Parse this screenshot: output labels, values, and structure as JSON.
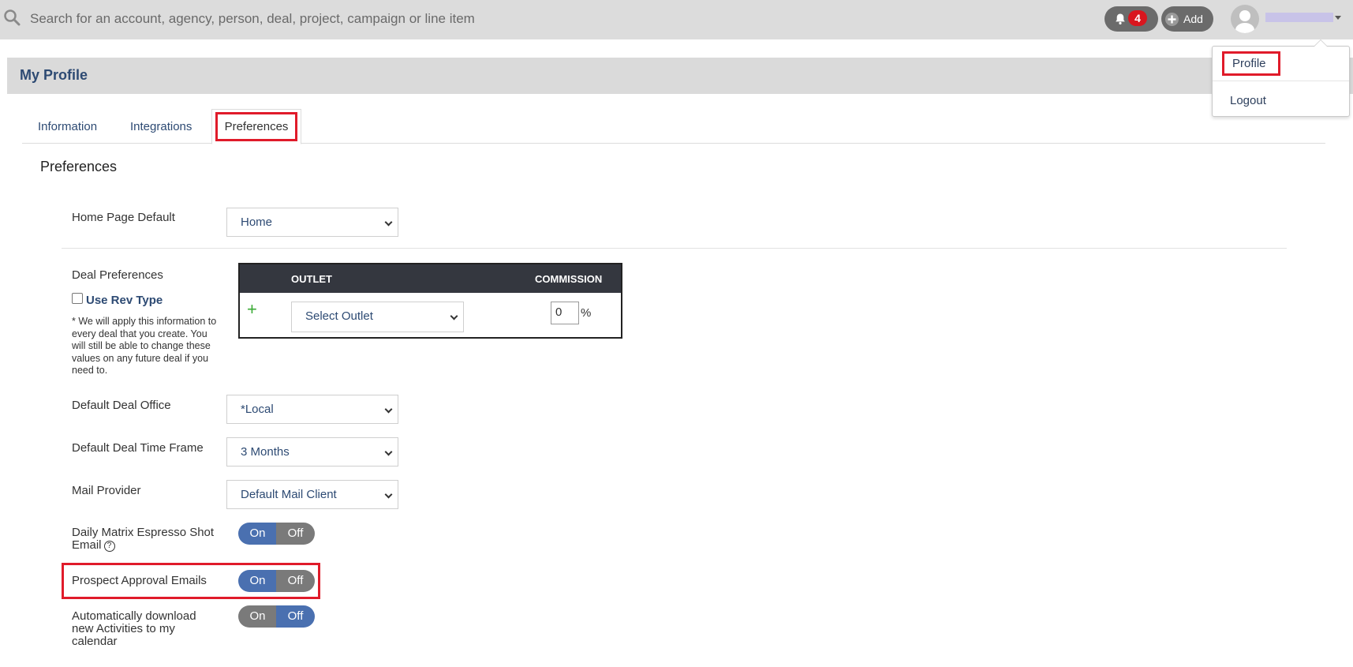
{
  "search": {
    "placeholder": "Search for an account, agency, person, deal, project, campaign or line item"
  },
  "header_actions": {
    "notification_count": "4",
    "add_label": "Add"
  },
  "user_menu": {
    "profile_label": "Profile",
    "logout_label": "Logout"
  },
  "page": {
    "title": "My Profile"
  },
  "tabs": [
    {
      "label": "Information"
    },
    {
      "label": "Integrations"
    },
    {
      "label": "Preferences",
      "active": true
    }
  ],
  "section_title": "Preferences",
  "home_page_default": {
    "label": "Home Page Default",
    "value": "Home"
  },
  "deal_preferences": {
    "label": "Deal Preferences",
    "use_rev_type_label": "Use Rev Type",
    "use_rev_type_checked": false,
    "note": "* We will apply this information to every deal that you create. You will still be able to change these values on any future deal if you need to.",
    "table": {
      "col_outlet": "OUTLET",
      "col_commission": "COMMISSION",
      "add_symbol": "+",
      "outlet_value": "Select Outlet",
      "commission_value": "0",
      "commission_unit": "%"
    }
  },
  "default_deal_office": {
    "label": "Default Deal Office",
    "value": "*Local"
  },
  "default_deal_time_frame": {
    "label": "Default Deal Time Frame",
    "value": "3 Months"
  },
  "mail_provider": {
    "label": "Mail Provider",
    "value": "Default Mail Client"
  },
  "toggles": {
    "on_label": "On",
    "off_label": "Off",
    "daily_matrix": {
      "label": "Daily Matrix Espresso Shot Email",
      "help_symbol": "?",
      "state": "On"
    },
    "prospect_approval": {
      "label": "Prospect Approval Emails",
      "state": "On"
    },
    "auto_download": {
      "label": "Automatically download new Activities to my calendar",
      "state": "Off"
    }
  },
  "colors": {
    "accent": "#4a70b0",
    "highlight": "#e01b2a",
    "header_bg": "#34373f",
    "badge": "#d9161e"
  },
  "icons": [
    "search-icon",
    "bell-icon",
    "add-circle-icon",
    "avatar-icon",
    "caret-down-icon",
    "plus-icon",
    "help-icon",
    "chevron-down-icon"
  ]
}
